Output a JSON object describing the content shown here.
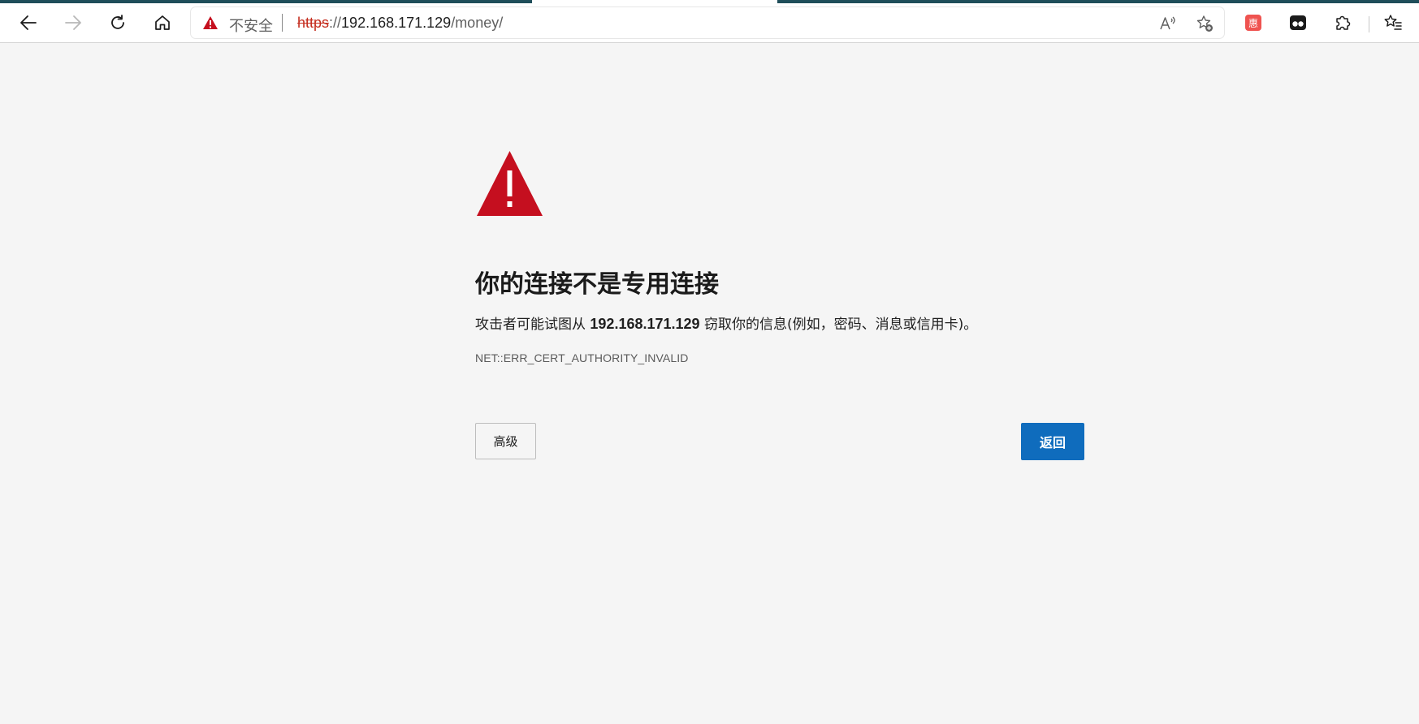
{
  "browser": {
    "tab_accent_color": "#1f4e5a",
    "toolbar": {
      "back_icon": "arrow-left-icon",
      "forward_icon": "arrow-right-icon",
      "refresh_icon": "refresh-icon",
      "home_icon": "home-icon"
    },
    "address_bar": {
      "security_label": "不安全",
      "url_scheme": "https",
      "url_sep": "://",
      "url_host": "192.168.171.129",
      "url_path": "/money/",
      "read_aloud_icon": "read-aloud-icon",
      "add_favorite_icon": "star-add-icon"
    },
    "extensions": {
      "ext1_label": "惠",
      "ext1_color": "#ef5350",
      "ext2_icon": "glasses-extension-icon",
      "puzzle_icon": "puzzle-icon",
      "favorites_icon": "favorites-list-icon"
    }
  },
  "page": {
    "warning_icon": "warning-triangle-icon",
    "warning_color": "#c50f1f",
    "heading": "你的连接不是专用连接",
    "desc_prefix": "攻击者可能试图从 ",
    "desc_host": "192.168.171.129",
    "desc_suffix": " 窃取你的信息(例如，密码、消息或信用卡)。",
    "error_code": "NET::ERR_CERT_AUTHORITY_INVALID",
    "advanced_button": "高级",
    "back_button": "返回",
    "back_button_color": "#0f6cbd"
  }
}
